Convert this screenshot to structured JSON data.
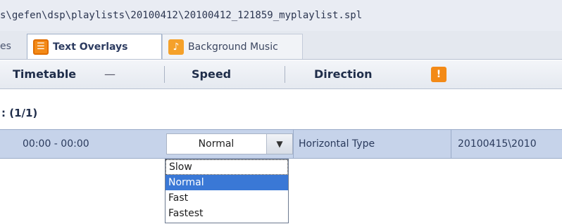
{
  "path_bar": {
    "text": "s\\gefen\\dsp\\playlists\\20100412\\20100412_121859_myplaylist.spl"
  },
  "tabs": [
    {
      "label": "es",
      "icon": ""
    },
    {
      "label": "Text Overlays",
      "icon": "text-overlay-icon"
    },
    {
      "label": "Background Music",
      "icon": "music-icon"
    }
  ],
  "header": {
    "timetable": "Timetable",
    "dash": "—",
    "speed": "Speed",
    "direction": "Direction",
    "icon_name": "add-overlay-icon"
  },
  "group": {
    "label": ": (1/1)"
  },
  "row": {
    "time": "00:00 - 00:00",
    "speed": "Normal",
    "direction": "Horizontal Type",
    "file": "20100415\\2010"
  },
  "speed_dropdown": {
    "options": [
      "Slow",
      "Normal",
      "Fast",
      "Fastest"
    ],
    "selected": "Normal"
  },
  "colors": {
    "accent_orange": "#f38a17",
    "selected_row": "#c6d3ea",
    "option_highlight": "#3a78d6"
  }
}
